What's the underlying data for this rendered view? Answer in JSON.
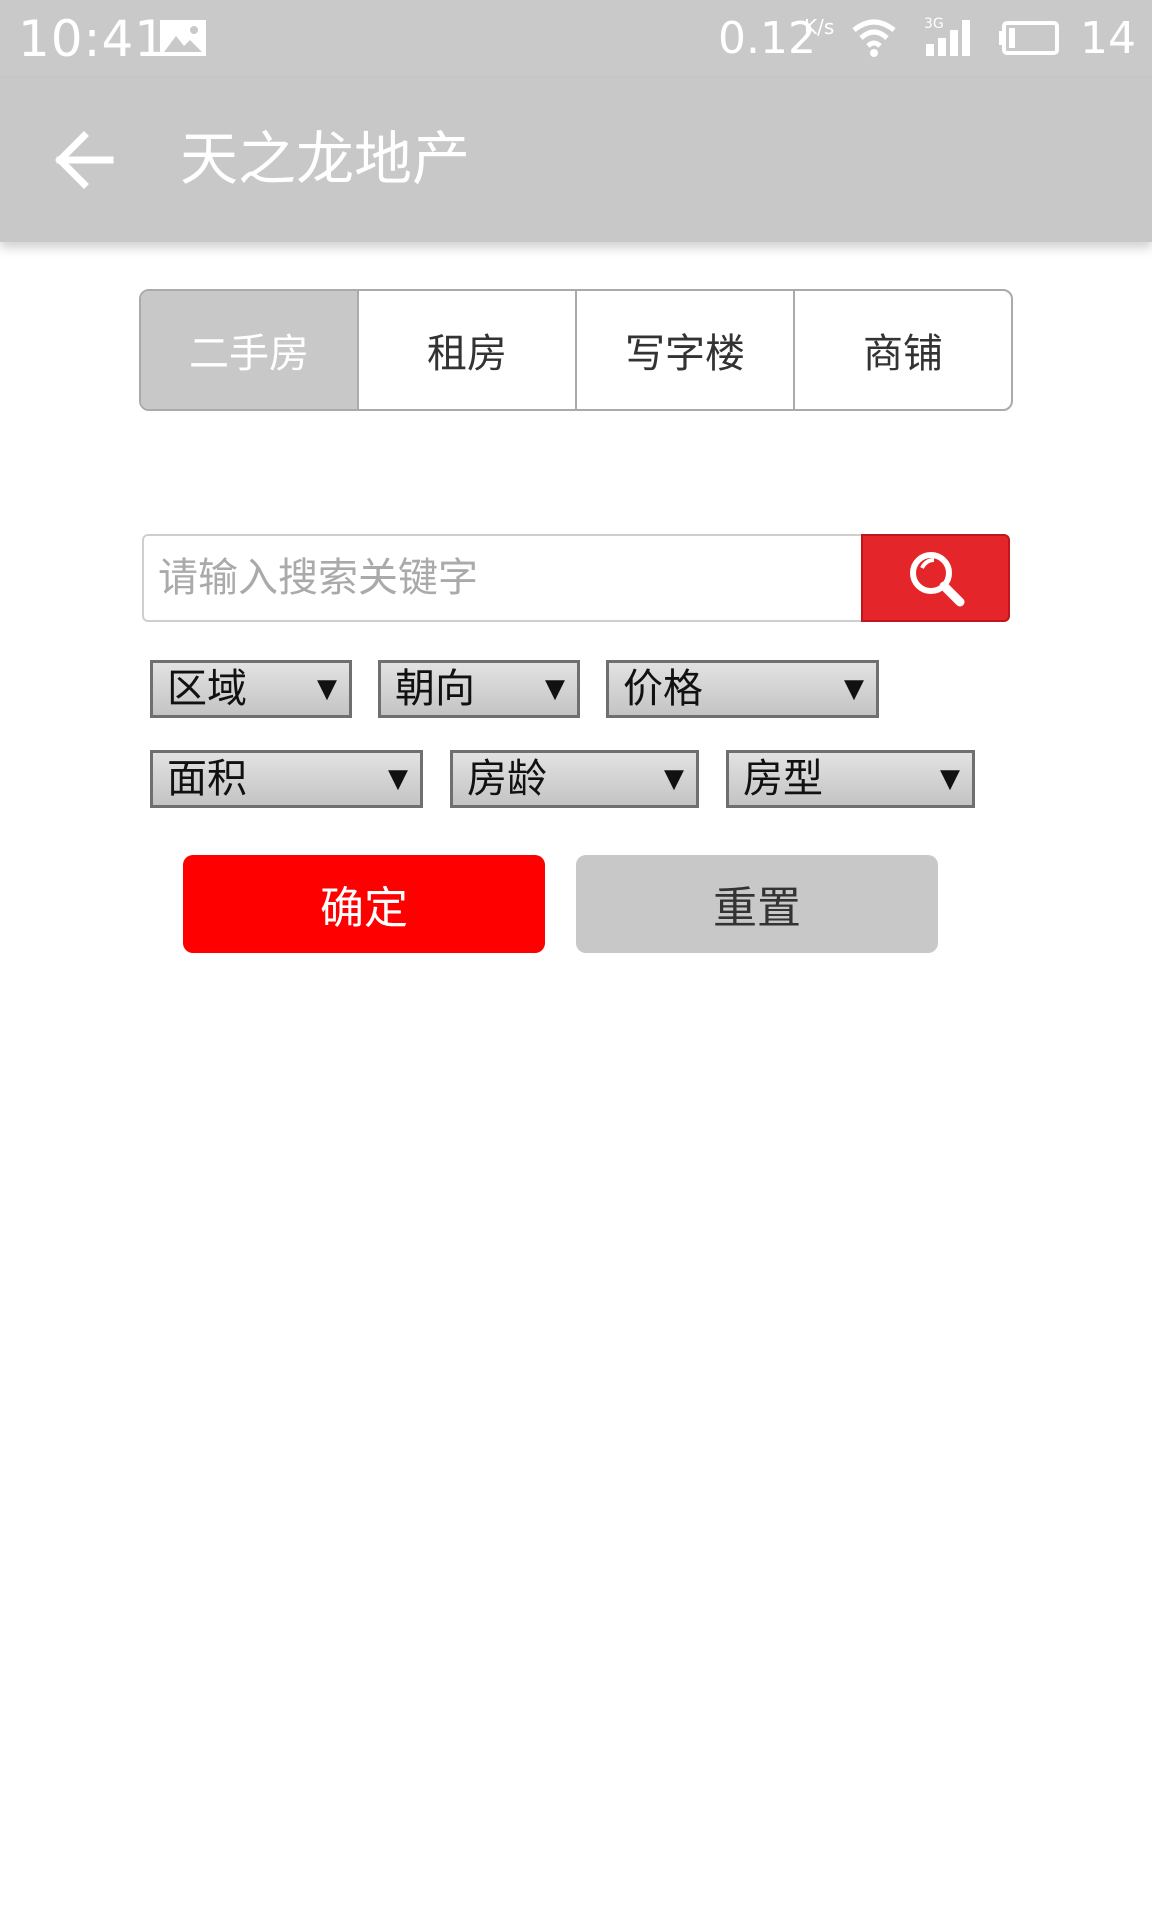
{
  "status_bar": {
    "time": "10:41",
    "net_speed": "0.12",
    "net_unit": "K/s",
    "battery_level": "14"
  },
  "app_bar": {
    "title": "天之龙地产"
  },
  "tabs": [
    {
      "label": "二手房",
      "active": true
    },
    {
      "label": "租房",
      "active": false
    },
    {
      "label": "写字楼",
      "active": false
    },
    {
      "label": "商铺",
      "active": false
    }
  ],
  "search": {
    "placeholder": "请输入搜索关键字",
    "value": ""
  },
  "filters": [
    {
      "label": "区域",
      "arrow": "▼"
    },
    {
      "label": "朝向",
      "arrow": "▼"
    },
    {
      "label": "价格",
      "arrow": "▼"
    },
    {
      "label": "面积",
      "arrow": "▼"
    },
    {
      "label": "房龄",
      "arrow": "▼"
    },
    {
      "label": "房型",
      "arrow": "▼"
    }
  ],
  "actions": {
    "confirm_label": "确定",
    "reset_label": "重置"
  },
  "colors": {
    "header_gray": "#c8c8c8",
    "search_red": "#e4262b",
    "confirm_red": "#ff0000"
  }
}
